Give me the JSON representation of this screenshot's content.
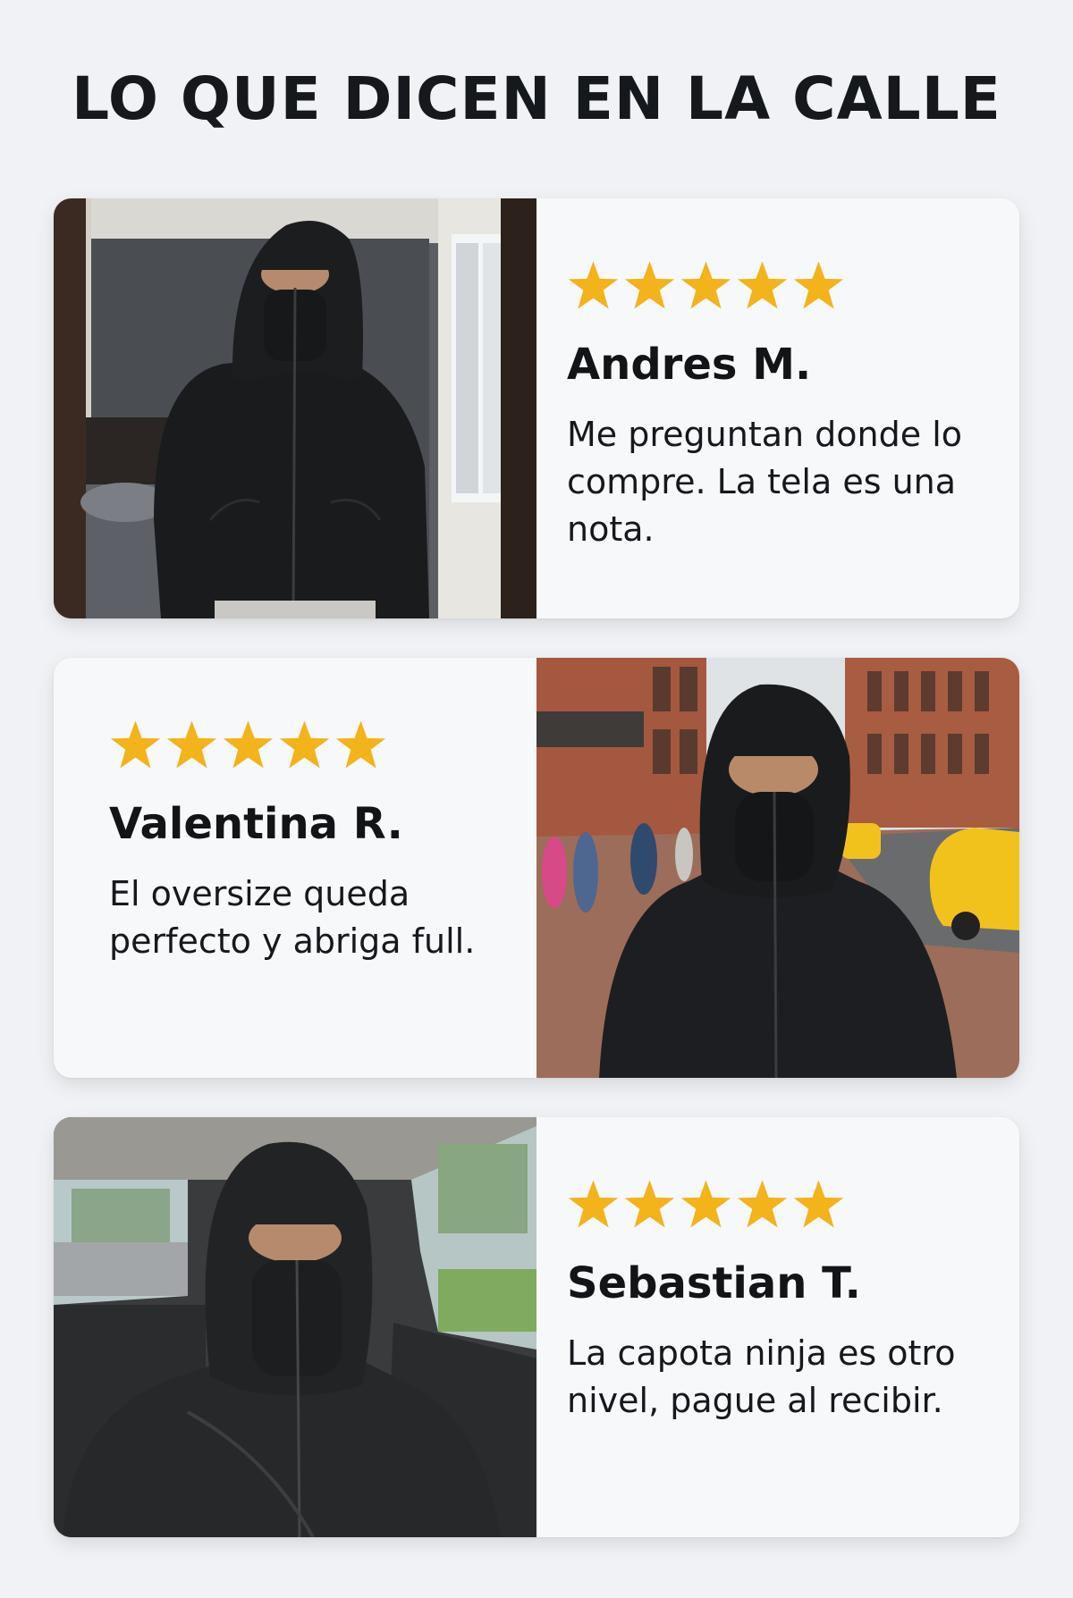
{
  "title": "LO QUE DICEN EN LA CALLE",
  "colors": {
    "background": "#f1f2f5",
    "card": "#f7f8fa",
    "star": "#f2b31b",
    "text": "#15181d"
  },
  "testimonials": [
    {
      "rating": 5,
      "name": "Andres M.",
      "text": "Me preguntan donde lo compre. La tela es una nota.",
      "photo": "man-in-black-ninja-hoodie-bedroom"
    },
    {
      "rating": 5,
      "name": "Valentina R.",
      "text": "El oversize queda perfecto y abriga full.",
      "photo": "woman-in-black-ninja-hoodie-street"
    },
    {
      "rating": 5,
      "name": "Sebastian T.",
      "text": "La capota ninja es otro nivel, pague al recibir.",
      "photo": "man-in-black-ninja-hoodie-car"
    }
  ]
}
